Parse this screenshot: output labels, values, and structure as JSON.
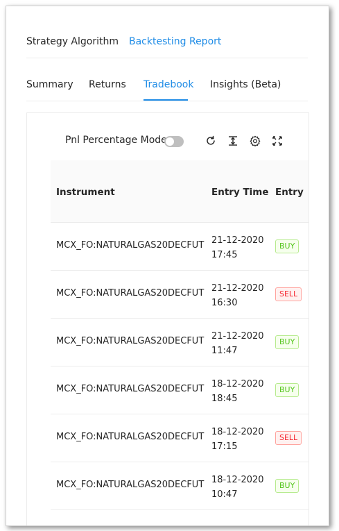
{
  "top_tabs": [
    {
      "label": "Strategy Algorithm",
      "active": false
    },
    {
      "label": "Backtesting Report",
      "active": true
    }
  ],
  "sub_tabs": [
    {
      "label": "Summary",
      "active": false
    },
    {
      "label": "Returns",
      "active": false
    },
    {
      "label": "Tradebook",
      "active": true
    },
    {
      "label": "Insights (Beta)",
      "active": false
    }
  ],
  "toolbar": {
    "pnl_mode_label": "Pnl Percentage Mode:",
    "pnl_mode_on": false,
    "icons": [
      "reload-icon",
      "column-height-icon",
      "setting-icon",
      "fullscreen-icon"
    ]
  },
  "table": {
    "columns": [
      "Instrument",
      "Entry Time",
      "Entry"
    ],
    "rows": [
      {
        "instrument": "MCX_FO:NATURALGAS20DECFUT",
        "date": "21-12-2020",
        "time": "17:45",
        "side": "BUY"
      },
      {
        "instrument": "MCX_FO:NATURALGAS20DECFUT",
        "date": "21-12-2020",
        "time": "16:30",
        "side": "SELL"
      },
      {
        "instrument": "MCX_FO:NATURALGAS20DECFUT",
        "date": "21-12-2020",
        "time": "11:47",
        "side": "BUY"
      },
      {
        "instrument": "MCX_FO:NATURALGAS20DECFUT",
        "date": "18-12-2020",
        "time": "18:45",
        "side": "BUY"
      },
      {
        "instrument": "MCX_FO:NATURALGAS20DECFUT",
        "date": "18-12-2020",
        "time": "17:15",
        "side": "SELL"
      },
      {
        "instrument": "MCX_FO:NATURALGAS20DECFUT",
        "date": "18-12-2020",
        "time": "10:47",
        "side": "BUY"
      }
    ]
  },
  "colors": {
    "accent": "#1f8ce6",
    "buy": "#52c41a",
    "sell": "#f5222d"
  }
}
